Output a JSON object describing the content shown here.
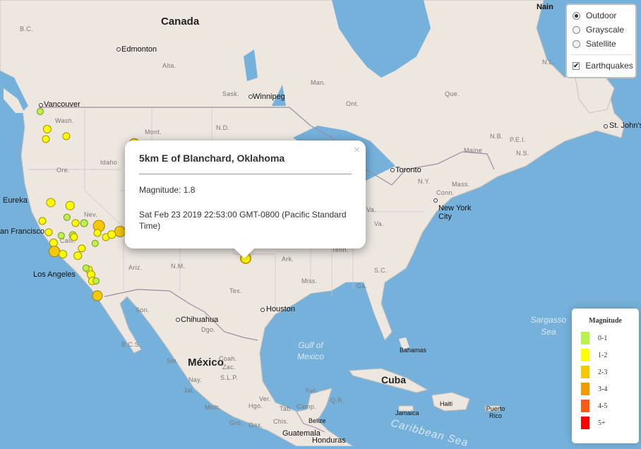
{
  "layer_control": {
    "base_layers": [
      {
        "label": "Outdoor",
        "selected": true
      },
      {
        "label": "Grayscale",
        "selected": false
      },
      {
        "label": "Satellite",
        "selected": false
      }
    ],
    "overlays": [
      {
        "label": "Earthquakes",
        "checked": true
      }
    ]
  },
  "popup": {
    "title": "5km E of Blanchard, Oklahoma",
    "magnitude": "Magnitude: 1.8",
    "time": "Sat Feb 23 2019 22:53:00 GMT-0800 (Pacific Standard Time)",
    "close_symbol": "×"
  },
  "legend": {
    "title": "Magnitude",
    "items": [
      {
        "label": "0-1",
        "color": "#b7f34d"
      },
      {
        "label": "1-2",
        "color": "#ffff00"
      },
      {
        "label": "2-3",
        "color": "#f6c800"
      },
      {
        "label": "3-4",
        "color": "#f59a00"
      },
      {
        "label": "4-5",
        "color": "#ff5a14"
      },
      {
        "label": "5+",
        "color": "#ff0000"
      }
    ]
  },
  "map_labels": {
    "countries": [
      "Canada",
      "México",
      "Cuba"
    ],
    "cities": [
      "Nain",
      "Edmonton",
      "Winnipeg",
      "Vancouver",
      "St. John's",
      "Toronto",
      "New York City",
      "Eureka",
      "an Francisco",
      "Los Angeles",
      "Houston",
      "Chihuahua",
      "Guatemala",
      "Honduras",
      "Bahamas",
      "Jamaica",
      "Haiti",
      "Puerto Rico",
      "Belize"
    ],
    "regions": [
      "B.C.",
      "Alta.",
      "Sask.",
      "Man.",
      "Ont.",
      "Que.",
      "N.L.",
      "N.B.",
      "P.E.I.",
      "N.S.",
      "Maine",
      "N.Y.",
      "Conn.",
      "Mass.",
      "Wash.",
      "Ore.",
      "Idaho",
      "Mont.",
      "N.D.",
      "Nev.",
      "Calif.",
      "Ariz.",
      "N.M.",
      "Tex.",
      "Ark.",
      "Tenn.",
      "Miss.",
      "Ga.",
      "S.C.",
      "Va.",
      "W.Va.",
      "Son.",
      "B.C.S.",
      "Dgo.",
      "Coah.",
      "Sin.",
      "Zac.",
      "S.L.P.",
      "Nay.",
      "Yuc.",
      "Camp.",
      "Tab.",
      "Chis.",
      "Oax.",
      "Gro.",
      "Mich.",
      "Jal.",
      "Ver.",
      "Hgo.",
      "Q.R."
    ],
    "seas": [
      "Gulf of Mexico",
      "Sargasso Sea",
      "Caribbean Sea"
    ]
  },
  "earthquakes": [
    {
      "lng": -97.61,
      "lat": 35.15,
      "magnitude": 1.8,
      "selected": true
    }
  ]
}
